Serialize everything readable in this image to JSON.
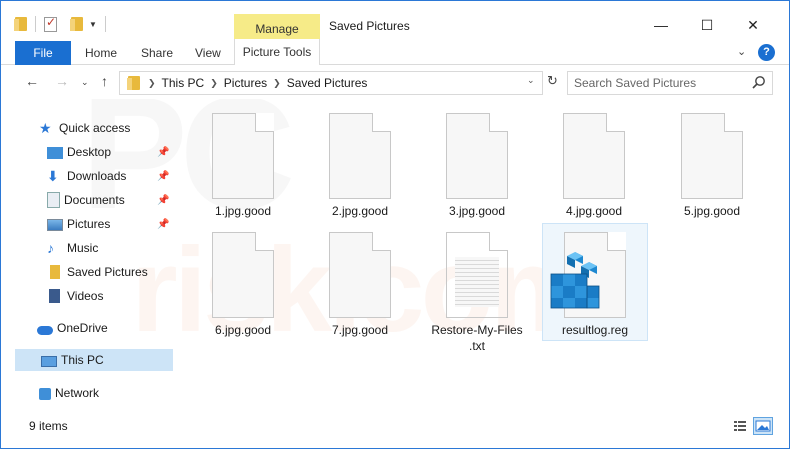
{
  "window": {
    "title": "Saved Pictures",
    "contextual_tab": "Manage",
    "minimize": "—",
    "maximize": "☐",
    "close": "✕"
  },
  "ribbon": {
    "tabs": [
      {
        "label": "File"
      },
      {
        "label": "Home"
      },
      {
        "label": "Share"
      },
      {
        "label": "View"
      },
      {
        "label": "Picture Tools"
      }
    ]
  },
  "address": {
    "crumbs": [
      "This PC",
      "Pictures",
      "Saved Pictures"
    ],
    "search_placeholder": "Search Saved Pictures"
  },
  "sidebar": {
    "items": [
      {
        "label": "Quick access",
        "icon": "star-icon"
      },
      {
        "label": "Desktop",
        "icon": "desktop-icon",
        "pinned": true
      },
      {
        "label": "Downloads",
        "icon": "download-icon",
        "pinned": true
      },
      {
        "label": "Documents",
        "icon": "documents-icon",
        "pinned": true
      },
      {
        "label": "Pictures",
        "icon": "pictures-icon",
        "pinned": true
      },
      {
        "label": "Music",
        "icon": "music-icon"
      },
      {
        "label": "Saved Pictures",
        "icon": "folder-icon"
      },
      {
        "label": "Videos",
        "icon": "videos-icon"
      },
      {
        "label": "OneDrive",
        "icon": "cloud-icon"
      },
      {
        "label": "This PC",
        "icon": "computer-icon",
        "selected": true
      },
      {
        "label": "Network",
        "icon": "network-icon"
      }
    ]
  },
  "files": [
    {
      "name": "1.jpg.good",
      "type": "generic"
    },
    {
      "name": "2.jpg.good",
      "type": "generic"
    },
    {
      "name": "3.jpg.good",
      "type": "generic"
    },
    {
      "name": "4.jpg.good",
      "type": "generic"
    },
    {
      "name": "5.jpg.good",
      "type": "generic"
    },
    {
      "name": "6.jpg.good",
      "type": "generic"
    },
    {
      "name": "7.jpg.good",
      "type": "generic"
    },
    {
      "name_line1": "Restore-My-Files",
      "name_line2": ".txt",
      "type": "text"
    },
    {
      "name": "resultlog.reg",
      "type": "registry",
      "selected": true
    }
  ],
  "status": {
    "item_count": "9 items"
  },
  "watermark": {
    "line1": "PC",
    "line2": "risk.com"
  },
  "colors": {
    "accent": "#1a6fd1",
    "manage_tab": "#f6eb88",
    "selection": "#cde4f7"
  }
}
